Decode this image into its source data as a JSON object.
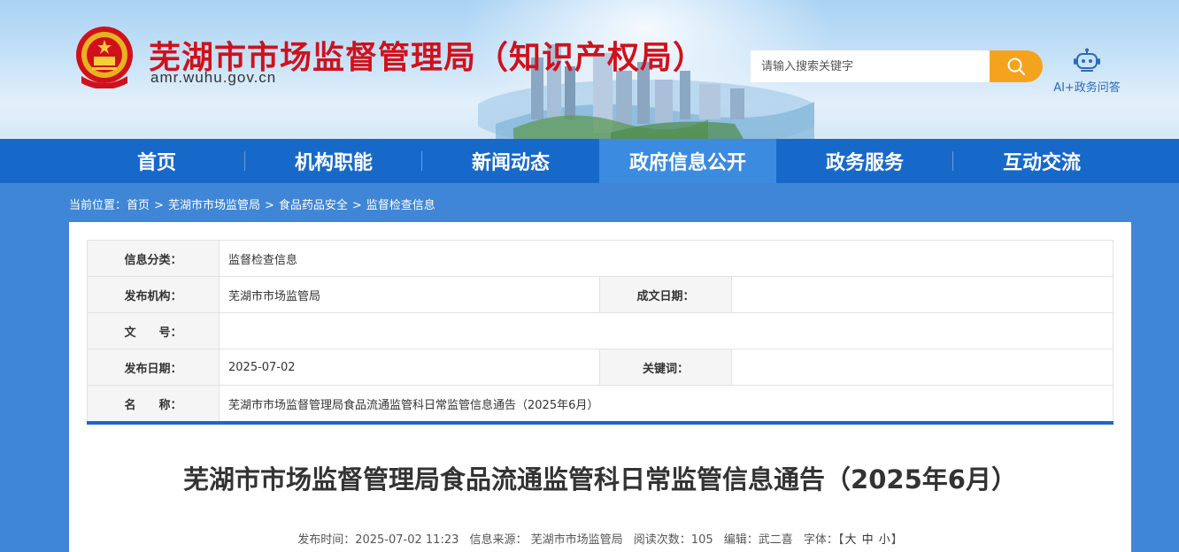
{
  "header": {
    "site_title": "芜湖市市场监督管理局（知识产权局）",
    "site_domain": "amr.wuhu.gov.cn",
    "search_placeholder": "请输入搜索关键字",
    "ai_label": "AI+政务问答"
  },
  "nav": {
    "items": [
      {
        "label": "首页"
      },
      {
        "label": "机构职能"
      },
      {
        "label": "新闻动态"
      },
      {
        "label": "政府信息公开"
      },
      {
        "label": "政务服务"
      },
      {
        "label": "互动交流"
      }
    ],
    "active_index": 3
  },
  "breadcrumb": {
    "prefix": "当前位置：",
    "items": [
      "首页",
      "芜湖市市场监管局",
      "食品药品安全",
      "监督检查信息"
    ],
    "separator": ">"
  },
  "info": {
    "category_label": "信息分类：",
    "category_value": "监督检查信息",
    "publisher_label": "发布机构：",
    "publisher_value": "芜湖市市场监管局",
    "written_date_label": "成文日期：",
    "written_date_value": "",
    "doc_no_label": "文　　号：",
    "doc_no_value": "",
    "publish_date_label": "发布日期：",
    "publish_date_value": "2025-07-02",
    "keywords_label": "关键词：",
    "keywords_value": "",
    "name_label": "名　　称：",
    "name_value": "芜湖市市场监督管理局食品流通监管科日常监管信息通告（2025年6月）"
  },
  "article": {
    "title": "芜湖市市场监督管理局食品流通监管科日常监管信息通告（2025年6月）",
    "publish_time": "发布时间：2025-07-02 11:23",
    "source": "信息来源：  芜湖市市场监管局",
    "views": "阅读次数：105",
    "editor": "编辑：武二喜",
    "font_label": "字体：【",
    "font_large": "大",
    "font_medium": "中",
    "font_small": "小",
    "font_close": "】"
  },
  "colors": {
    "title_red": "#d0111b",
    "nav_blue": "#1769c9",
    "nav_active": "#3b8be0",
    "search_orange": "#f5a31f"
  }
}
